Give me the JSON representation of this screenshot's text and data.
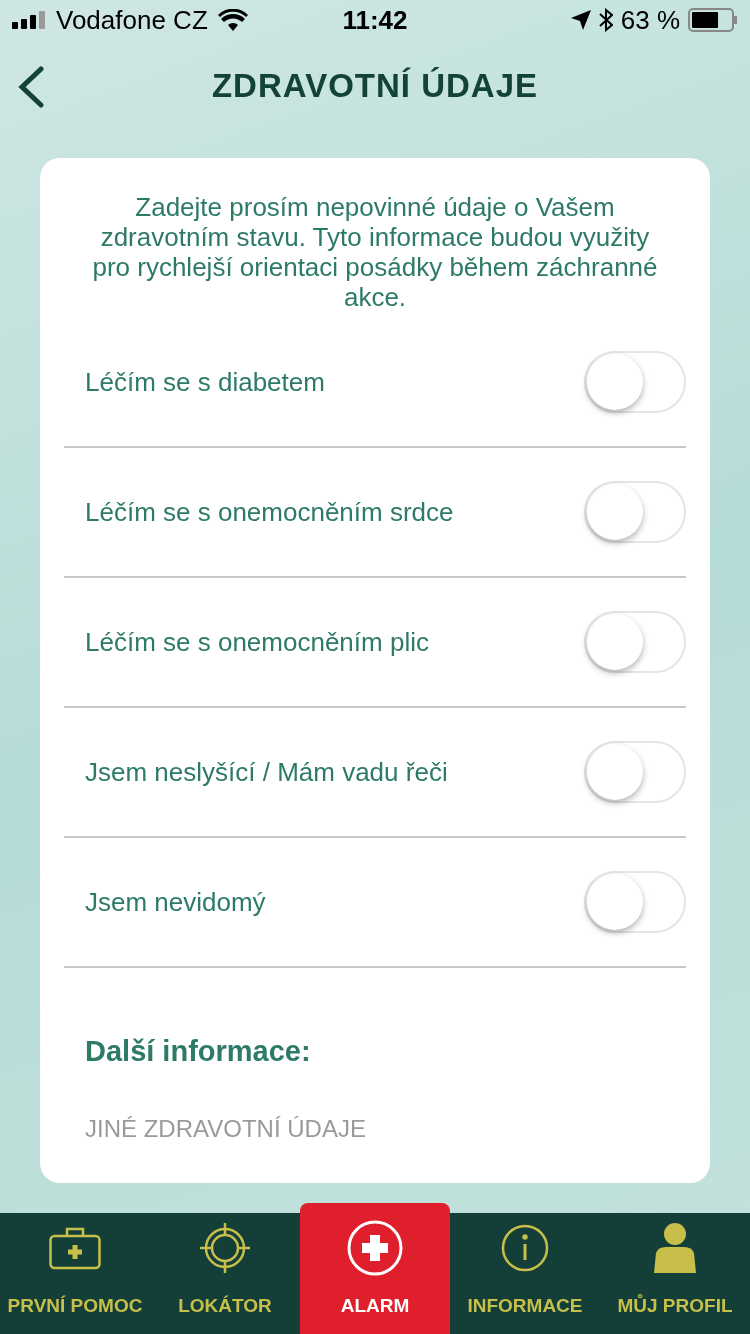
{
  "status_bar": {
    "carrier": "Vodafone CZ",
    "time": "11:42",
    "battery": "63 %"
  },
  "nav": {
    "title": "ZDRAVOTNÍ ÚDAJE"
  },
  "intro": "Zadejte prosím nepovinné údaje o Vašem zdravotním stavu. Tyto informace budou využity pro rychlejší orientaci posádky během záchranné akce.",
  "toggles": [
    {
      "label": "Léčím se s diabetem",
      "on": false
    },
    {
      "label": "Léčím se s onemocněním srdce",
      "on": false
    },
    {
      "label": "Léčím se s onemocněním plic",
      "on": false
    },
    {
      "label": "Jsem neslyšící / Mám vadu řeči",
      "on": false
    },
    {
      "label": "Jsem nevidomý",
      "on": false
    }
  ],
  "more": {
    "heading": "Další informace:",
    "placeholder": "JINÉ ZDRAVOTNÍ ÚDAJE"
  },
  "tabs": [
    {
      "label": "PRVNÍ POMOC",
      "kind": "kit",
      "selected": false
    },
    {
      "label": "LOKÁTOR",
      "kind": "target",
      "selected": false
    },
    {
      "label": "ALARM",
      "kind": "alarm",
      "selected": true
    },
    {
      "label": "INFORMACE",
      "kind": "info",
      "selected": false
    },
    {
      "label": "MŮJ PROFIL",
      "kind": "profile",
      "selected": false
    }
  ]
}
